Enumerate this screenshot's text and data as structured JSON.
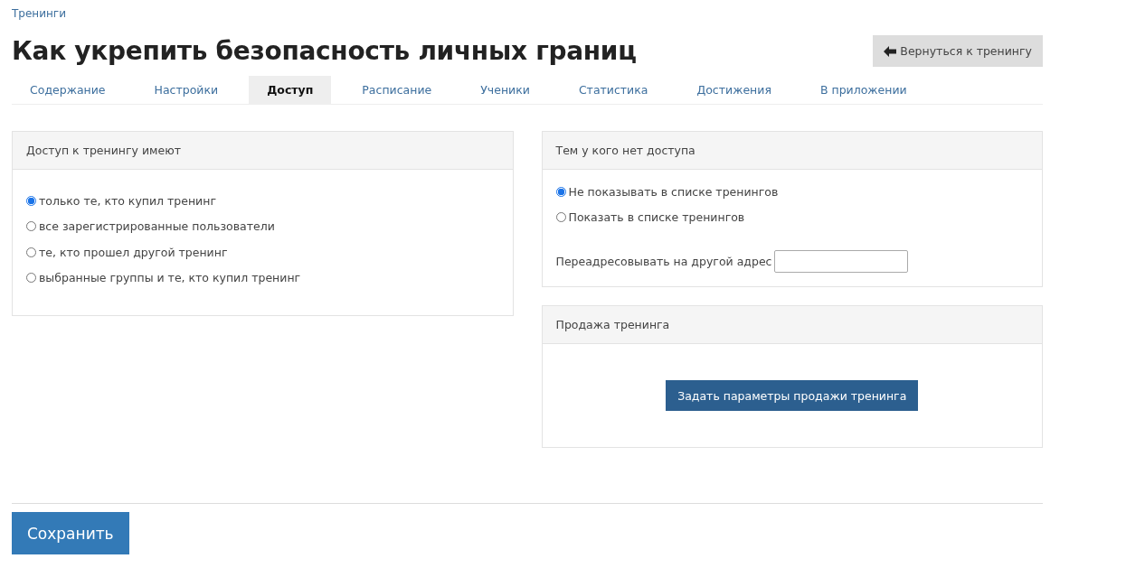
{
  "breadcrumb": "Тренинги",
  "title": "Как укрепить безопасность личных границ",
  "back_button": {
    "label": "Вернуться к тренингу"
  },
  "tabs": [
    {
      "label": "Содержание",
      "selected": false
    },
    {
      "label": "Настройки",
      "selected": false
    },
    {
      "label": "Доступ",
      "selected": true
    },
    {
      "label": "Расписание",
      "selected": false
    },
    {
      "label": "Ученики",
      "selected": false
    },
    {
      "label": "Статистика",
      "selected": false
    },
    {
      "label": "Достижения",
      "selected": false
    },
    {
      "label": "В приложении",
      "selected": false
    }
  ],
  "access_panel": {
    "title": "Доступ к тренингу имеют",
    "options": [
      {
        "label": "только те, кто купил тренинг",
        "selected": true
      },
      {
        "label": "все зарегистрированные пользователи",
        "selected": false
      },
      {
        "label": "те, кто прошел другой тренинг",
        "selected": false
      },
      {
        "label": "выбранные группы и те, кто купил тренинг",
        "selected": false
      }
    ]
  },
  "no_access_panel": {
    "title": "Тем у кого нет доступа",
    "options": [
      {
        "label": "Не показывать в списке тренингов",
        "selected": true
      },
      {
        "label": "Показать в списке тренингов",
        "selected": false
      }
    ],
    "redirect_label": "Переадресовывать на другой адрес"
  },
  "sale_panel": {
    "title": "Продажа тренинга",
    "button": "Задать параметры продажи тренинга"
  },
  "save_button": "Сохранить"
}
